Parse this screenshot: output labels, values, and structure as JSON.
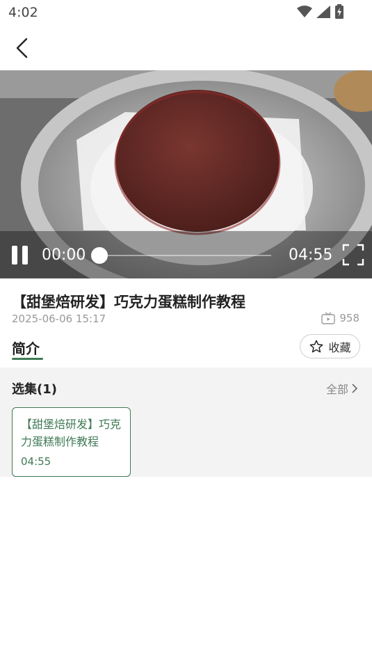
{
  "status_bar": {
    "time": "4:02",
    "icons": [
      "wifi-icon",
      "signal-icon",
      "battery-charging-icon"
    ]
  },
  "nav": {
    "back_icon": "chevron-left-icon"
  },
  "video": {
    "current_time": "00:00",
    "total_time": "04:55",
    "progress": 0,
    "state": "playing"
  },
  "info": {
    "title": "【甜堡焙研发】巧克力蛋糕制作教程",
    "date": "2025-06-06 15:17",
    "views": "958"
  },
  "tabs": {
    "intro_label": "简介"
  },
  "favorite": {
    "label": "收藏",
    "icon": "star-outline-icon"
  },
  "episodes": {
    "title": "选集(1)",
    "all_label": "全部",
    "items": [
      {
        "title": "【甜堡焙研发】巧克力蛋糕制作教程",
        "duration": "04:55"
      }
    ]
  },
  "colors": {
    "accent": "#3f7a55",
    "muted_text": "#999999",
    "section_bg": "#f3f3f3"
  }
}
